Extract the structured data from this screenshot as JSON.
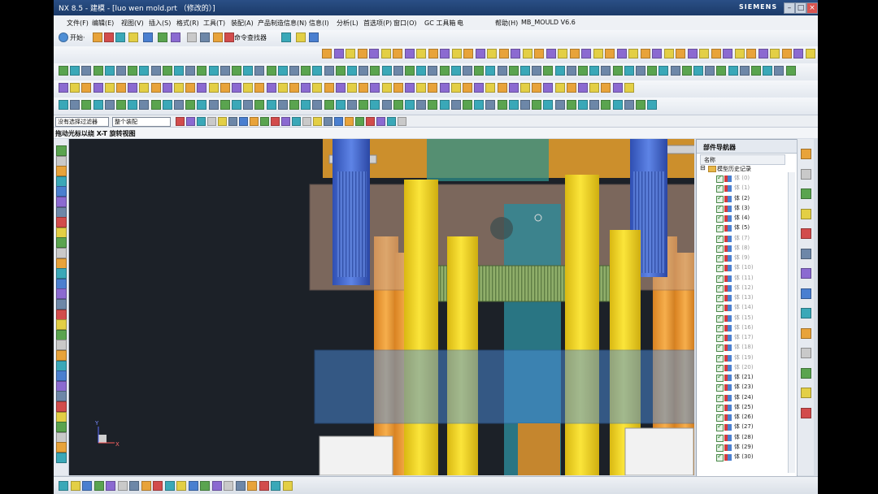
{
  "window": {
    "title": "NX 8.5 - 建模 - [luo wen mold.prt （修改的）]",
    "brand": "SIEMENS",
    "controls": [
      "–",
      "□",
      "×"
    ]
  },
  "menu": [
    "文件(F)",
    "编辑(E)",
    "视图(V)",
    "插入(S)",
    "格式(R)",
    "工具(T)",
    "装配(A)",
    "产品制造信息(N)",
    "信息(I)",
    "分析(L)",
    "首选项(P)",
    "窗口(O)",
    "GC 工具箱",
    "电",
    "帮助(H)",
    "MB_MOULD V6.6"
  ],
  "standard_toolbar": {
    "start": "开始·",
    "command_finder": "命令查找器"
  },
  "filter_bar": {
    "type_filter": "没有选择过滤器",
    "scope": "整个装配"
  },
  "cue": "拖动光标以绕 X-T 旋转视图",
  "navigator": {
    "title": "部件导航器",
    "column": "名称",
    "root": "模型历史记录",
    "items": [
      {
        "label": "体 (0)",
        "dim": true
      },
      {
        "label": "体 (1)",
        "dim": true
      },
      {
        "label": "体 (2)",
        "dim": false
      },
      {
        "label": "体 (3)",
        "dim": false
      },
      {
        "label": "体 (4)",
        "dim": false
      },
      {
        "label": "体 (5)",
        "dim": false
      },
      {
        "label": "体 (7)",
        "dim": true
      },
      {
        "label": "体 (8)",
        "dim": true
      },
      {
        "label": "体 (9)",
        "dim": true
      },
      {
        "label": "体 (10)",
        "dim": true
      },
      {
        "label": "体 (11)",
        "dim": true
      },
      {
        "label": "体 (12)",
        "dim": true
      },
      {
        "label": "体 (13)",
        "dim": true
      },
      {
        "label": "体 (14)",
        "dim": true
      },
      {
        "label": "体 (15)",
        "dim": true
      },
      {
        "label": "体 (16)",
        "dim": true
      },
      {
        "label": "体 (17)",
        "dim": true
      },
      {
        "label": "体 (18)",
        "dim": true
      },
      {
        "label": "体 (19)",
        "dim": true
      },
      {
        "label": "体 (20)",
        "dim": true
      },
      {
        "label": "体 (21)",
        "dim": false
      },
      {
        "label": "体 (23)",
        "dim": false
      },
      {
        "label": "体 (24)",
        "dim": false
      },
      {
        "label": "体 (25)",
        "dim": false
      },
      {
        "label": "体 (26)",
        "dim": false
      },
      {
        "label": "体 (27)",
        "dim": false
      },
      {
        "label": "体 (28)",
        "dim": false
      },
      {
        "label": "体 (29)",
        "dim": false
      },
      {
        "label": "体 (30)",
        "dim": false
      }
    ]
  },
  "triad": {
    "x": "X",
    "y": "Y"
  },
  "colors": {
    "titlebar": "#1b3a68",
    "viewport": "#1c2128",
    "pillar_yellow": "#f2d51f",
    "pillar_blue": "#3f63c9",
    "gear_green": "#7a9a55"
  }
}
